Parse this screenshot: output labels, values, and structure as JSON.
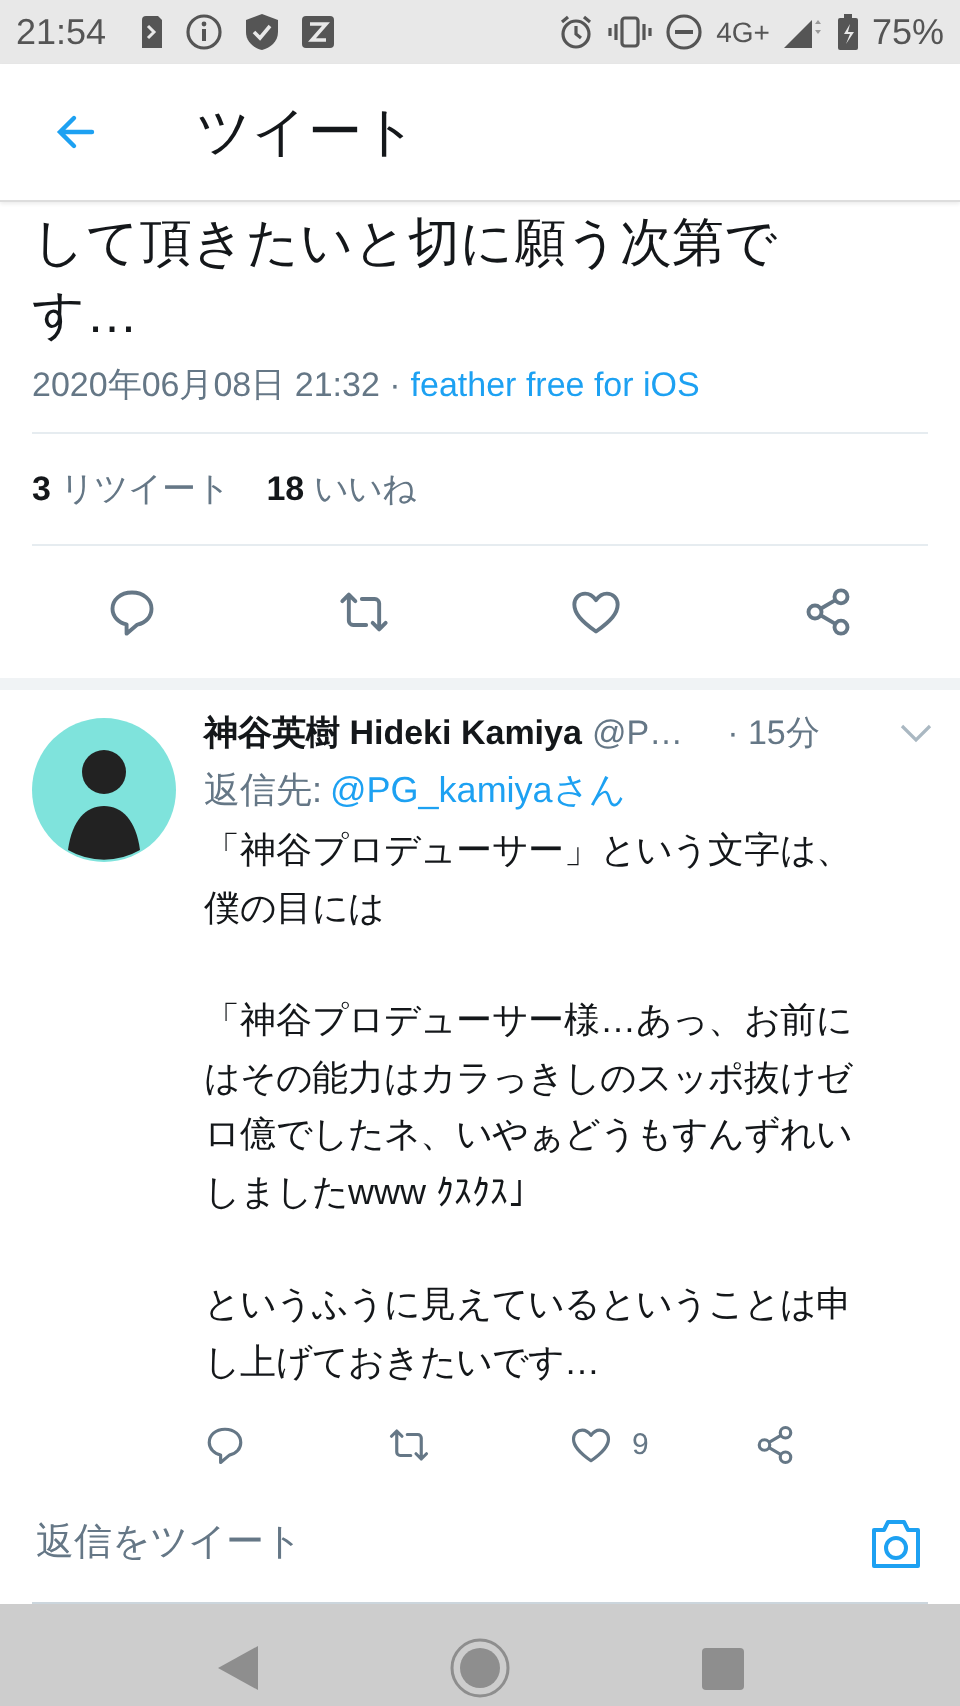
{
  "status_bar": {
    "time": "21:54",
    "network": "4G+",
    "battery": "75%"
  },
  "header": {
    "title": "ツイート"
  },
  "tweet": {
    "text": "して頂きたいと切に願う次第です…",
    "timestamp": "2020年06月08日 21:32 ·",
    "source": "feather free for iOS",
    "stats": [
      {
        "count": "3",
        "label": "リツイート"
      },
      {
        "count": "18",
        "label": "いいね"
      }
    ],
    "actions": [
      {
        "kind": "reply"
      },
      {
        "kind": "retweet"
      },
      {
        "kind": "like"
      },
      {
        "kind": "share"
      }
    ]
  },
  "reply": {
    "name": "神谷英樹 Hideki Kamiya",
    "handle": "@P…",
    "time": "· 15分",
    "reply_to_label": "返信先:",
    "reply_to": "@PG_kamiyaさん",
    "paragraphs": [
      "「神谷プロデューサー」という文字は、僕の目には",
      "「神谷プロデューサー様…あっ、お前にはその能力はカラっきしのスッポ抜けゼロ億でしたネ、いやぁどうもすんずれいしましたwww ｸｽｸｽ」",
      "というふうに見えているということは申し上げておきたいです…"
    ],
    "actions": [
      {
        "kind": "reply"
      },
      {
        "kind": "retweet"
      },
      {
        "kind": "like",
        "count": "9"
      },
      {
        "kind": "share"
      }
    ]
  },
  "composer": {
    "placeholder": "返信をツイート"
  }
}
